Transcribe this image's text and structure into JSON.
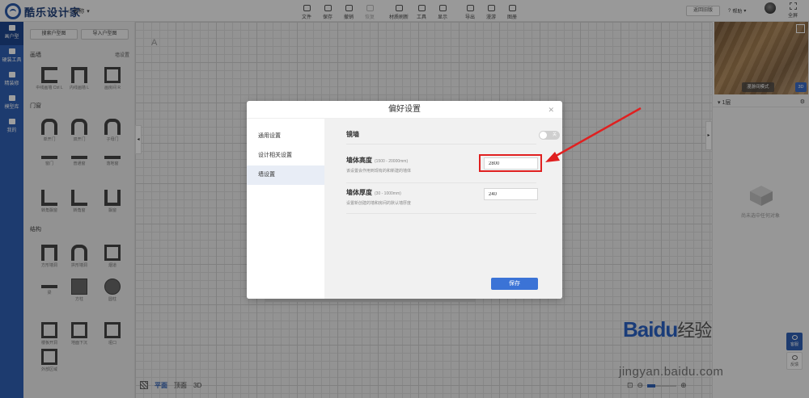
{
  "app": {
    "logo_text": "酷乐设计家",
    "doc_name": "名称"
  },
  "toolbar": [
    {
      "label": "文件",
      "disabled": false
    },
    {
      "label": "保存",
      "disabled": false
    },
    {
      "label": "撤销",
      "disabled": false
    },
    {
      "label": "恢复",
      "disabled": true
    },
    {
      "label": "材质刷新",
      "disabled": false
    },
    {
      "label": "工具",
      "disabled": false
    },
    {
      "label": "显示",
      "disabled": false
    },
    {
      "label": "导出",
      "disabled": false
    },
    {
      "label": "漫游",
      "disabled": false
    },
    {
      "label": "图册",
      "disabled": false
    }
  ],
  "header_right": {
    "back_label": "返回旧版",
    "help_label": "帮助",
    "fullscreen_label": "全屏"
  },
  "nav": [
    {
      "label": "画户型",
      "active": true
    },
    {
      "label": "硬装工具",
      "active": false
    },
    {
      "label": "精装修",
      "active": false
    },
    {
      "label": "模型库",
      "active": false
    },
    {
      "label": "我的",
      "active": false
    }
  ],
  "library": {
    "buttons": [
      "搜索户型图",
      "导入户型图"
    ],
    "sections": [
      {
        "title": "画墙",
        "action": "墙设置",
        "items": [
          "中线画墙 Ctrl L",
          "内线画墙 L",
          "画房间 R"
        ]
      },
      {
        "title": "门窗",
        "action": "",
        "items": [
          "单开门",
          "双开门",
          "子母门",
          "窗门",
          "普通窗",
          "落地窗",
          "转角飘窗",
          "转角窗",
          "飘窗"
        ]
      },
      {
        "title": "结构",
        "action": "",
        "items": [
          "方形墙洞",
          "拱形墙洞",
          "烟道",
          "梁",
          "方柱",
          "圆柱",
          "楼板开洞",
          "地面下沉",
          "垭口",
          "外部区域"
        ]
      }
    ]
  },
  "canvas": {
    "north_label": "A"
  },
  "bottom_bar": {
    "views": [
      "平面",
      "顶面",
      "3D"
    ],
    "active_view": "平面"
  },
  "right_panel": {
    "roam_button": "漫游间模式",
    "mode_3d": "3D",
    "floor_label": "1层",
    "empty_text": "尚未选中任何对象"
  },
  "float_buttons": [
    {
      "label": "客服"
    },
    {
      "label": "反馈"
    }
  ],
  "dialog": {
    "title": "偏好设置",
    "tabs": [
      "通用设置",
      "设计相关设置",
      "墙设置"
    ],
    "active_tab": "墙设置",
    "mirror_wall": {
      "label": "镜墙",
      "toggle_text": "关",
      "on": false
    },
    "wall_height": {
      "label": "墙体高度",
      "range": "(1500 - 20000mm)",
      "desc": "该设置会作用到现有的和新建的墙体",
      "value": "2800"
    },
    "wall_thickness": {
      "label": "墙体厚度",
      "range": "(30 - 1000mm)",
      "desc": "设置新创建的墙和房间的默认墙厚度",
      "value": "240"
    },
    "save_label": "保存"
  },
  "watermark": {
    "brand": "Baidu",
    "brand_cn": "经验",
    "url": "jingyan.baidu.com"
  },
  "colors": {
    "nav_blue": "#2f5fb3",
    "primary_button": "#3b73d6",
    "highlight_red": "#e02020"
  }
}
